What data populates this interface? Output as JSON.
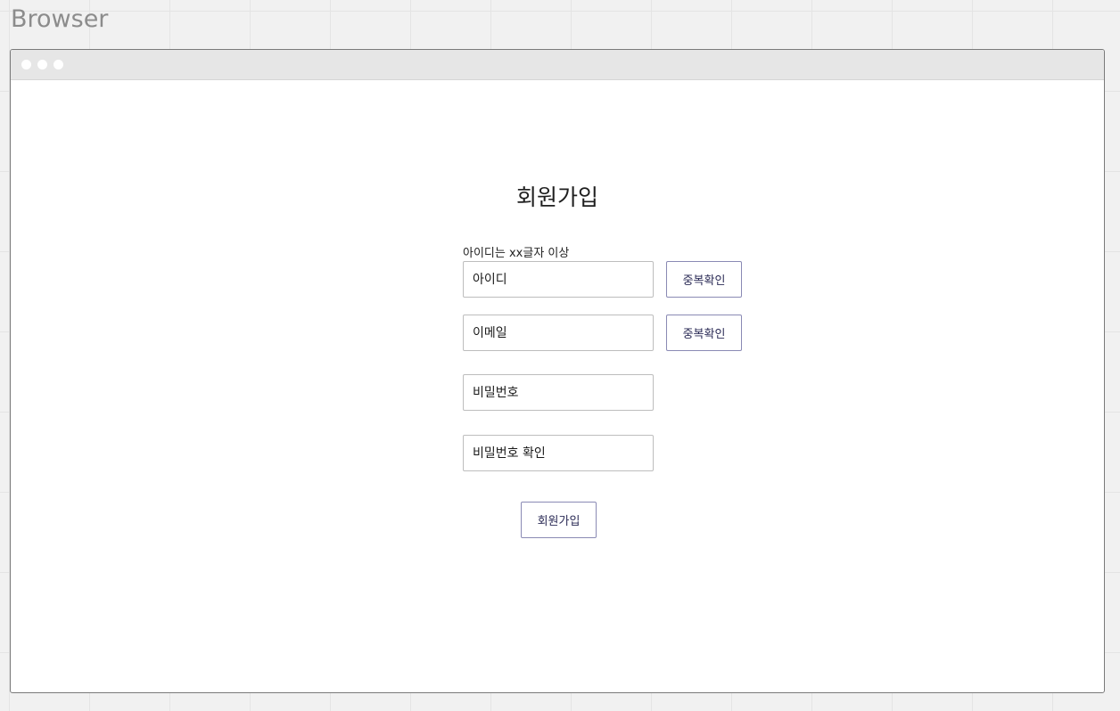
{
  "frame": {
    "label": "Browser"
  },
  "form": {
    "title": "회원가입",
    "id_helper": "아이디는 xx글자 이상",
    "id_placeholder": "아이디",
    "email_placeholder": "이메일",
    "password_placeholder": "비밀번호",
    "password_confirm_placeholder": "비밀번호 확인",
    "check_duplicate_label": "중복확인",
    "submit_label": "회원가입"
  },
  "colors": {
    "button_border": "#8a8ab4",
    "button_text": "#2a2a55",
    "input_border": "#bdbdbd",
    "titlebar": "#e6e6e6"
  }
}
